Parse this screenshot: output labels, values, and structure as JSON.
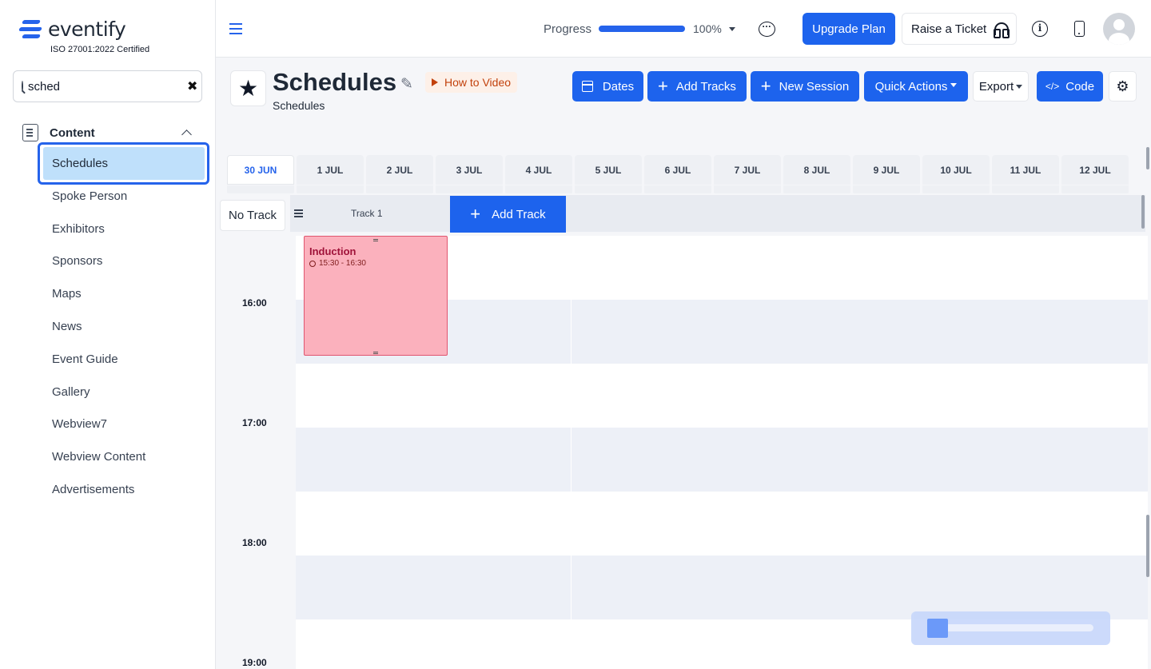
{
  "brand": {
    "name": "eventify",
    "tagline": "ISO 27001:2022 Certified"
  },
  "search": {
    "value": "sched",
    "clear_icon": "close-icon"
  },
  "sidebar": {
    "group_label": "Content",
    "items": [
      {
        "label": "Schedules",
        "active": true
      },
      {
        "label": "Spoke Person"
      },
      {
        "label": "Exhibitors"
      },
      {
        "label": "Sponsors"
      },
      {
        "label": "Maps"
      },
      {
        "label": "News"
      },
      {
        "label": "Event Guide"
      },
      {
        "label": "Gallery"
      },
      {
        "label": "Webview7"
      },
      {
        "label": "Webview Content"
      },
      {
        "label": "Advertisements"
      }
    ]
  },
  "topbar": {
    "progress_label": "Progress",
    "progress_value": 100,
    "progress_text": "100%",
    "upgrade_label": "Upgrade Plan",
    "ticket_label": "Raise a Ticket"
  },
  "page": {
    "title": "Schedules",
    "subtitle": "Schedules",
    "how_to_label": "How to Video"
  },
  "actions": {
    "dates": "Dates",
    "add_tracks": "Add Tracks",
    "new_session": "New Session",
    "quick_actions": "Quick Actions",
    "export": "Export",
    "code": "Code"
  },
  "dates": [
    "30 JUN",
    "1 JUL",
    "2 JUL",
    "3 JUL",
    "4 JUL",
    "5 JUL",
    "6 JUL",
    "7 JUL",
    "8 JUL",
    "9 JUL",
    "10 JUL",
    "11 JUL",
    "12 JUL"
  ],
  "active_date": "30 JUN",
  "tracks": {
    "no_track": "No Track",
    "track1": "Track 1",
    "add_track": "Add Track"
  },
  "times": [
    "16:00",
    "17:00",
    "18:00",
    "19:00"
  ],
  "session": {
    "name": "Induction",
    "time": "15:30 - 16:30"
  },
  "colors": {
    "primary": "#1d63ed",
    "session_bg": "#fbb1bd",
    "session_text": "#9f1239",
    "active_nav": "#bfe0fb"
  }
}
